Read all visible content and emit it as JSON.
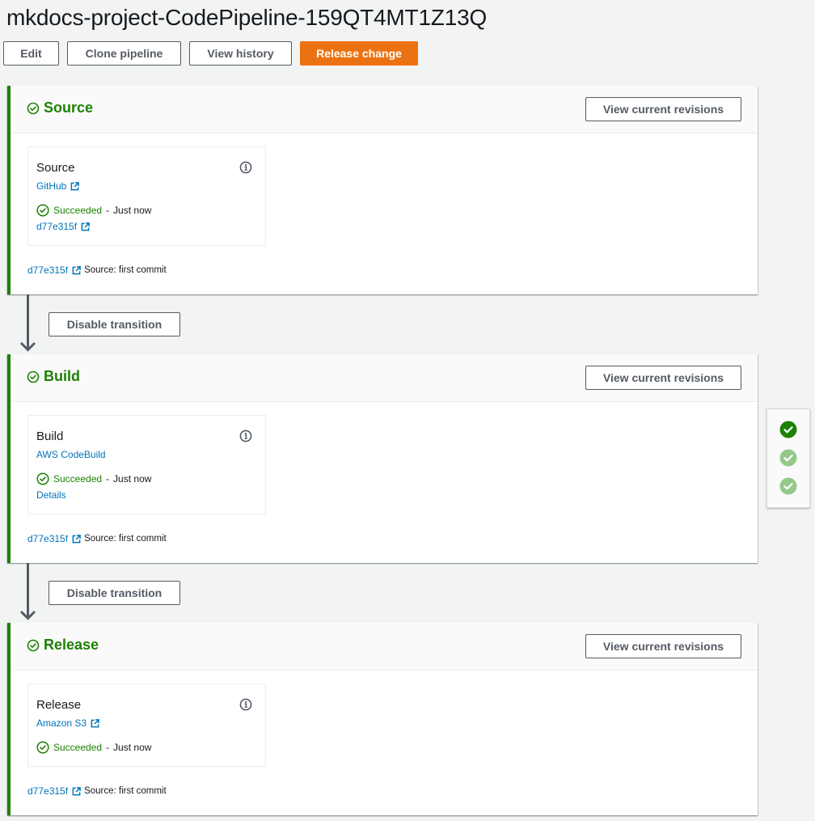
{
  "header": {
    "title": "mkdocs-project-CodePipeline-159QT4MT1Z13Q",
    "buttons": {
      "edit": "Edit",
      "clone": "Clone pipeline",
      "history": "View history",
      "release": "Release change"
    }
  },
  "colors": {
    "success": "#1d8102",
    "link": "#0073bb",
    "primary": "#ec7211"
  },
  "stages": [
    {
      "name": "Source",
      "status_icon": "check-circle-icon",
      "view_revisions_label": "View current revisions",
      "action": {
        "name": "Source",
        "provider": "GitHub",
        "provider_external": true,
        "status": "Succeeded",
        "separator": "-",
        "time": "Just now",
        "extra_link": "d77e315f",
        "extra_link_external": true
      },
      "revision": {
        "id": "d77e315f",
        "message": "Source: first commit"
      }
    },
    {
      "name": "Build",
      "status_icon": "check-circle-icon",
      "view_revisions_label": "View current revisions",
      "action": {
        "name": "Build",
        "provider": "AWS CodeBuild",
        "provider_external": false,
        "status": "Succeeded",
        "separator": "-",
        "time": "Just now",
        "extra_link": "Details",
        "extra_link_external": false
      },
      "revision": {
        "id": "d77e315f",
        "message": "Source: first commit"
      }
    },
    {
      "name": "Release",
      "status_icon": "check-circle-icon",
      "view_revisions_label": "View current revisions",
      "action": {
        "name": "Release",
        "provider": "Amazon S3",
        "provider_external": true,
        "status": "Succeeded",
        "separator": "-",
        "time": "Just now"
      },
      "revision": {
        "id": "d77e315f",
        "message": "Source: first commit"
      }
    }
  ],
  "transitions": [
    {
      "label": "Disable transition"
    },
    {
      "label": "Disable transition"
    }
  ],
  "stage_navigator": {
    "items": [
      {
        "stage": "Source",
        "state": "active"
      },
      {
        "stage": "Build",
        "state": "inactive"
      },
      {
        "stage": "Release",
        "state": "inactive"
      }
    ]
  }
}
